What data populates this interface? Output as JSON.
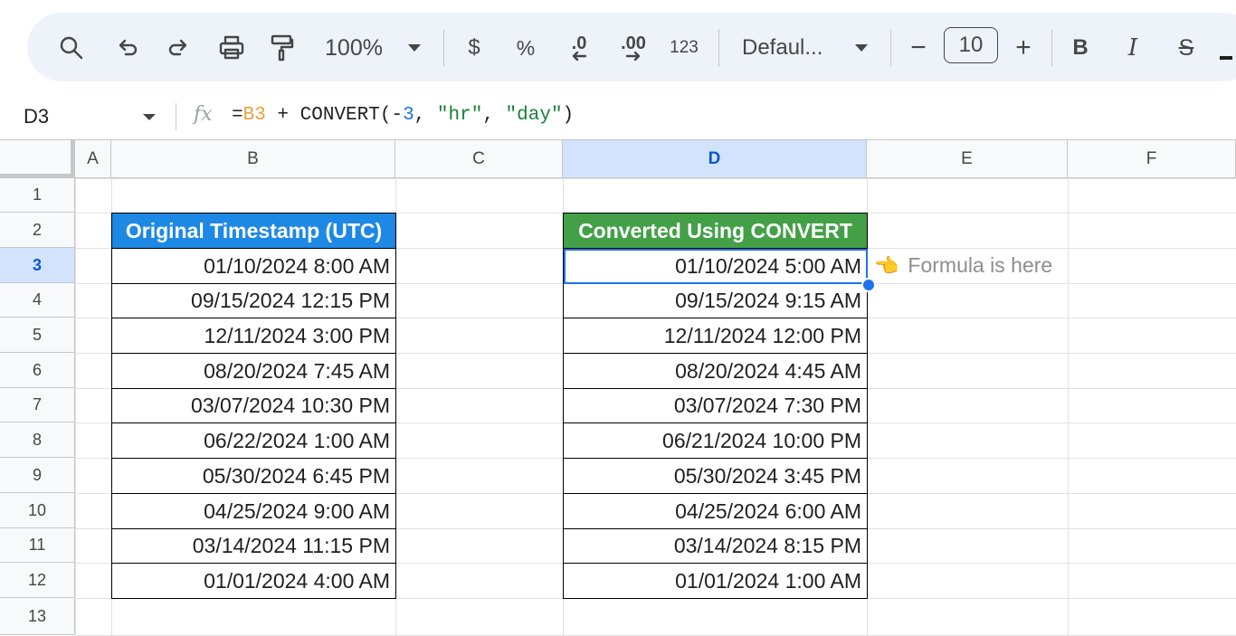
{
  "toolbar": {
    "zoom": "100%",
    "currency": "$",
    "percent": "%",
    "dec_decrease": ".0",
    "dec_increase": ".00",
    "number_format": "123",
    "font_name": "Defaul...",
    "font_size": "10",
    "minus": "−",
    "plus": "+",
    "bold": "B",
    "italic": "I",
    "strike": "S",
    "icons": [
      "search-icon",
      "undo-icon",
      "redo-icon",
      "print-icon",
      "paint-format-icon",
      "dropdown-icon",
      "decrease-decimal-icon",
      "increase-decimal-icon",
      "bold-icon",
      "italic-icon",
      "strikethrough-icon"
    ]
  },
  "formula_bar": {
    "name_box": "D3",
    "fx": "fx",
    "formula_parts": [
      "=",
      "B3",
      " + CONVERT(-",
      "3",
      ", ",
      "\"hr\"",
      ", ",
      "\"day\"",
      ")"
    ]
  },
  "sheet": {
    "columns": [
      "A",
      "B",
      "C",
      "D",
      "E",
      "F"
    ],
    "selected_column": "D",
    "rows": [
      "1",
      "2",
      "3",
      "4",
      "5",
      "6",
      "7",
      "8",
      "9",
      "10",
      "11",
      "12",
      "13"
    ],
    "selected_row": "3",
    "header_b": "Original Timestamp (UTC)",
    "header_d": "Converted Using CONVERT",
    "original": [
      "01/10/2024 8:00 AM",
      "09/15/2024 12:15 PM",
      "12/11/2024 3:00 PM",
      "08/20/2024 7:45 AM",
      "03/07/2024 10:30 PM",
      "06/22/2024 1:00 AM",
      "05/30/2024 6:45 PM",
      "04/25/2024 9:00 AM",
      "03/14/2024 11:15 PM",
      "01/01/2024 4:00 AM"
    ],
    "converted": [
      "01/10/2024 5:00 AM",
      "09/15/2024 9:15 AM",
      "12/11/2024 12:00 PM",
      "08/20/2024 4:45 AM",
      "03/07/2024 7:30 PM",
      "06/21/2024 10:00 PM",
      "05/30/2024 3:45 PM",
      "04/25/2024 6:00 AM",
      "03/14/2024 8:15 PM",
      "01/01/2024 1:00 AM"
    ],
    "note": "Formula is here",
    "note_icon": "👈",
    "colors": {
      "blue_header": "#1e88e5",
      "green_header": "#43a047",
      "selection": "#1a73e8"
    }
  }
}
